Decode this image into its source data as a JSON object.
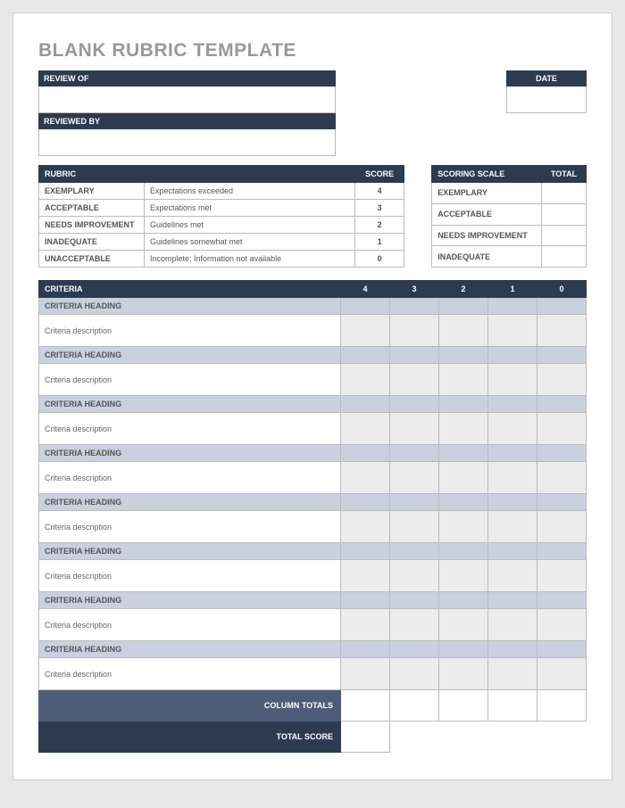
{
  "title": "BLANK RUBRIC TEMPLATE",
  "header": {
    "review_of": "REVIEW OF",
    "reviewed_by": "REVIEWED BY",
    "date": "DATE"
  },
  "rubric_table": {
    "col_rubric": "RUBRIC",
    "col_score": "SCORE",
    "rows": [
      {
        "label": "EXEMPLARY",
        "desc": "Expectations exceeded",
        "score": "4"
      },
      {
        "label": "ACCEPTABLE",
        "desc": "Expectations met",
        "score": "3"
      },
      {
        "label": "NEEDS IMPROVEMENT",
        "desc": "Guidelines met",
        "score": "2"
      },
      {
        "label": "INADEQUATE",
        "desc": "Guidelines somewhat met",
        "score": "1"
      },
      {
        "label": "UNACCEPTABLE",
        "desc": "Incomplete; Information not available",
        "score": "0"
      }
    ]
  },
  "scoring_table": {
    "col_scale": "SCORING SCALE",
    "col_total": "TOTAL",
    "rows": [
      {
        "label": "EXEMPLARY"
      },
      {
        "label": "ACCEPTABLE"
      },
      {
        "label": "NEEDS IMPROVEMENT"
      },
      {
        "label": "INADEQUATE"
      }
    ]
  },
  "criteria_table": {
    "col_criteria": "CRITERIA",
    "cols": [
      "4",
      "3",
      "2",
      "1",
      "0"
    ],
    "heading_label": "CRITERIA HEADING",
    "desc_label": "Criteria description",
    "row_count": 8,
    "column_totals": "COLUMN TOTALS",
    "total_score": "TOTAL SCORE"
  }
}
